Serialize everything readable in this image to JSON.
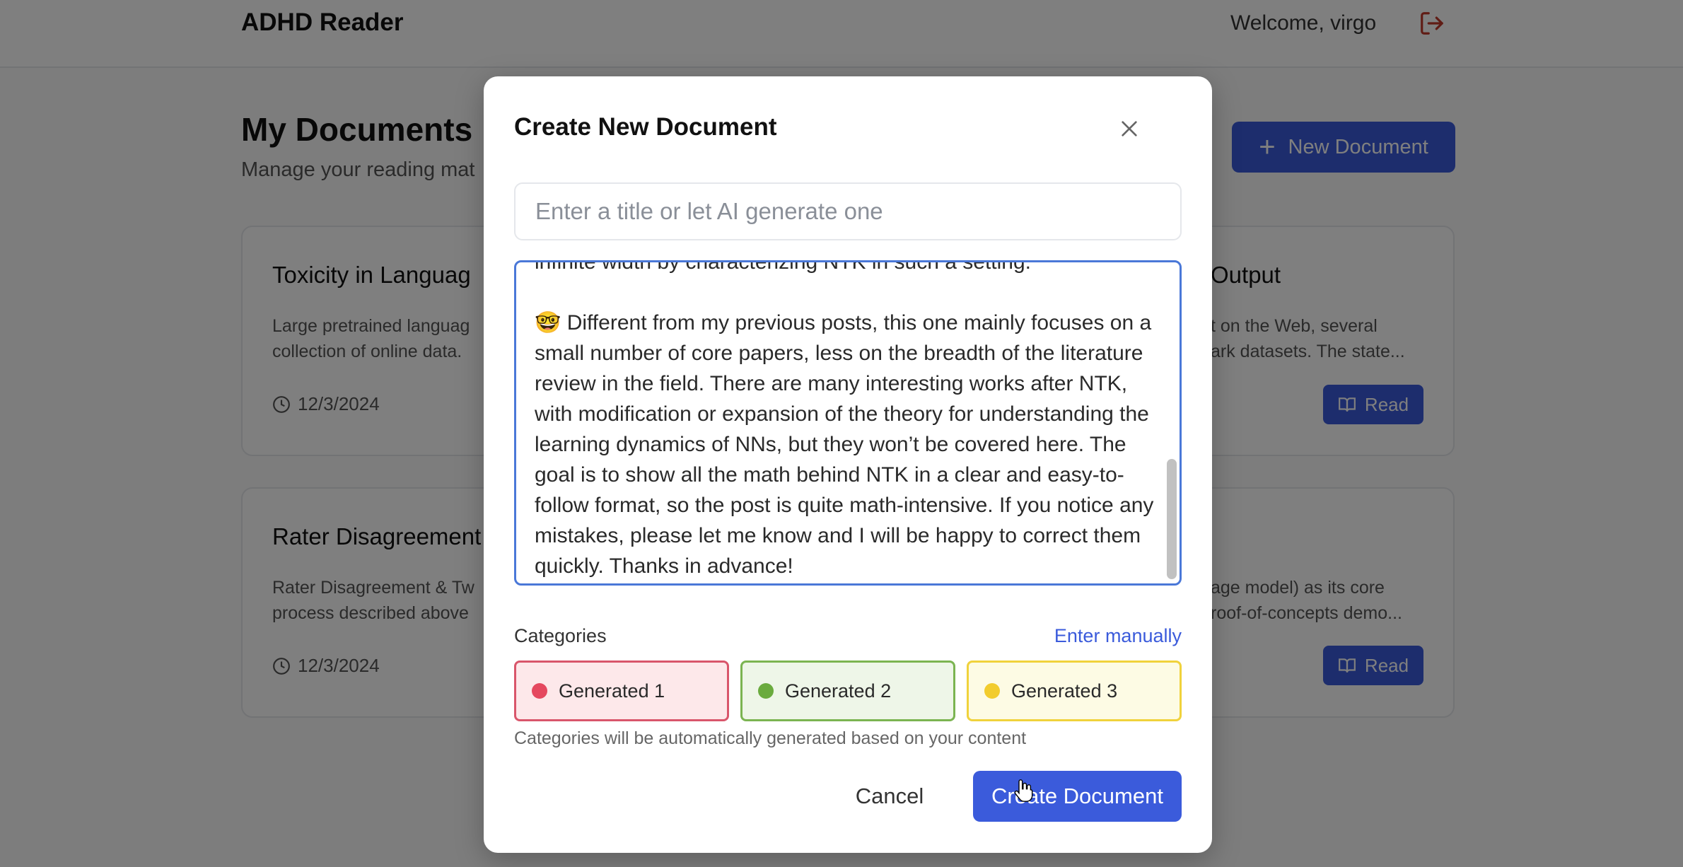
{
  "header": {
    "app_title": "ADHD Reader",
    "welcome": "Welcome, virgo",
    "logout_icon": "logout-icon"
  },
  "page": {
    "title": "My Documents",
    "subtitle": "Manage your reading mat",
    "new_document_label": "New Document"
  },
  "cards": [
    {
      "title": "Toxicity in Languag",
      "desc_line1": "Large pretrained languag",
      "desc_line2": "collection of online data.",
      "date": "12/3/2024"
    },
    {
      "title": "Output",
      "desc_line1": "t on the Web, several",
      "desc_line2": "ark datasets. The state...",
      "read_label": "Read"
    },
    {
      "title": "Rater Disagreement",
      "desc_line1": "Rater Disagreement & Tw",
      "desc_line2": "process described above",
      "date": "12/3/2024"
    },
    {
      "desc_line1": "age model) as its core",
      "desc_line2": "roof-of-concepts demo...",
      "read_label": "Read"
    }
  ],
  "modal": {
    "title": "Create New Document",
    "title_placeholder": "Enter a title or let AI generate one",
    "content_text": "infinite width by characterizing NTK in such a setting.\n\n🤓 Different from my previous posts, this one mainly focuses on a small number of core papers, less on the breadth of the literature review in the field. There are many interesting works after NTK, with modification or expansion of the theory for understanding the learning dynamics of NNs, but they won’t be covered here. The goal is to show all the math behind NTK in a clear and easy-to-follow format, so the post is quite math-intensive. If you notice any mistakes, please let me know and I will be happy to correct them quickly. Thanks in advance!",
    "categories_label": "Categories",
    "enter_manually": "Enter manually",
    "chips": [
      {
        "label": "Generated 1",
        "color": "#e5485f",
        "bg": "#fde8ea",
        "border": "#d9566b"
      },
      {
        "label": "Generated 2",
        "color": "#6aab3e",
        "bg": "#eef6e8",
        "border": "#7bb451"
      },
      {
        "label": "Generated 3",
        "color": "#f2cc2d",
        "bg": "#fdfbe4",
        "border": "#f0d23c"
      }
    ],
    "categories_help": "Categories will be automatically generated based on your content",
    "cancel_label": "Cancel",
    "create_label": "Create Document"
  },
  "colors": {
    "accent": "#3b5bdb",
    "logout": "#c0392b"
  }
}
